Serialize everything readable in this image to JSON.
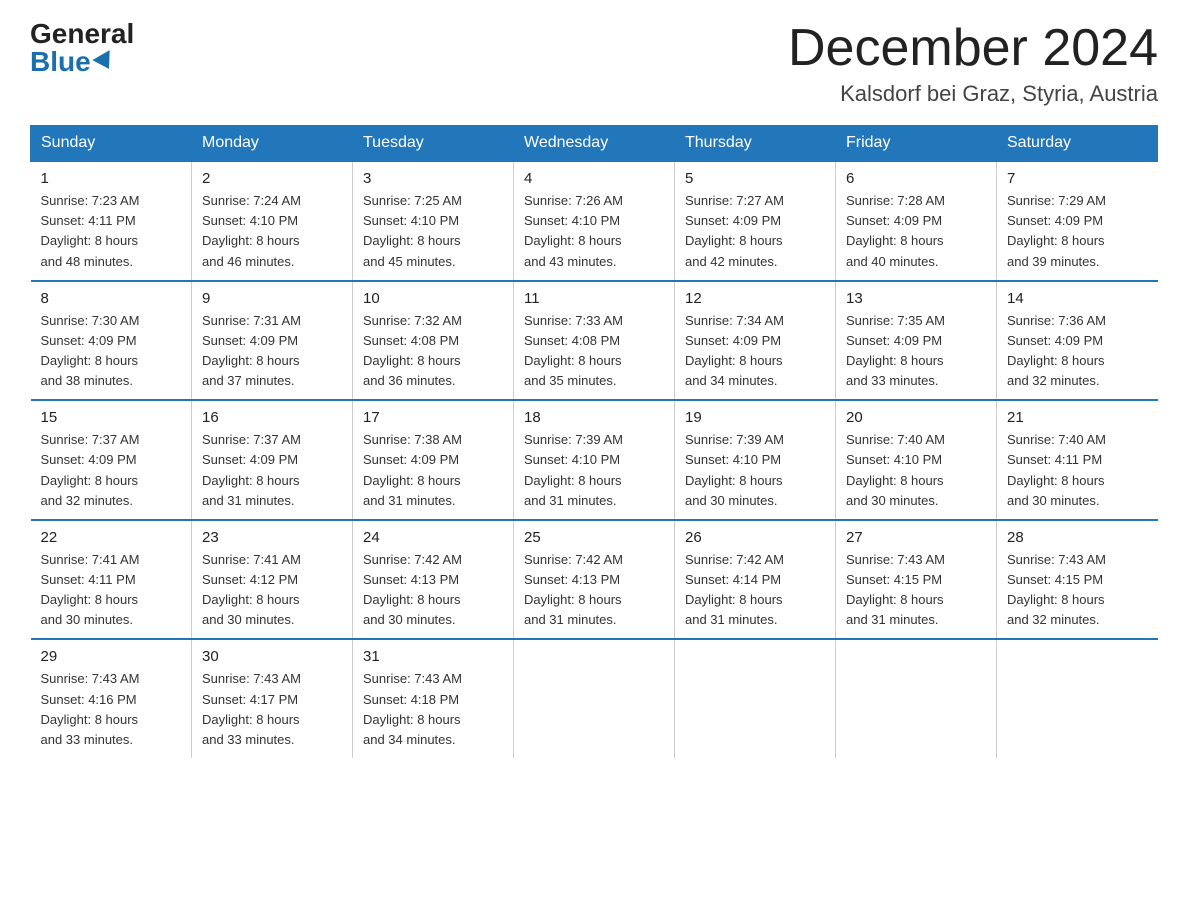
{
  "header": {
    "logo_general": "General",
    "logo_blue": "Blue",
    "month_title": "December 2024",
    "location": "Kalsdorf bei Graz, Styria, Austria"
  },
  "weekdays": [
    "Sunday",
    "Monday",
    "Tuesday",
    "Wednesday",
    "Thursday",
    "Friday",
    "Saturday"
  ],
  "weeks": [
    [
      {
        "day": "1",
        "info": "Sunrise: 7:23 AM\nSunset: 4:11 PM\nDaylight: 8 hours\nand 48 minutes."
      },
      {
        "day": "2",
        "info": "Sunrise: 7:24 AM\nSunset: 4:10 PM\nDaylight: 8 hours\nand 46 minutes."
      },
      {
        "day": "3",
        "info": "Sunrise: 7:25 AM\nSunset: 4:10 PM\nDaylight: 8 hours\nand 45 minutes."
      },
      {
        "day": "4",
        "info": "Sunrise: 7:26 AM\nSunset: 4:10 PM\nDaylight: 8 hours\nand 43 minutes."
      },
      {
        "day": "5",
        "info": "Sunrise: 7:27 AM\nSunset: 4:09 PM\nDaylight: 8 hours\nand 42 minutes."
      },
      {
        "day": "6",
        "info": "Sunrise: 7:28 AM\nSunset: 4:09 PM\nDaylight: 8 hours\nand 40 minutes."
      },
      {
        "day": "7",
        "info": "Sunrise: 7:29 AM\nSunset: 4:09 PM\nDaylight: 8 hours\nand 39 minutes."
      }
    ],
    [
      {
        "day": "8",
        "info": "Sunrise: 7:30 AM\nSunset: 4:09 PM\nDaylight: 8 hours\nand 38 minutes."
      },
      {
        "day": "9",
        "info": "Sunrise: 7:31 AM\nSunset: 4:09 PM\nDaylight: 8 hours\nand 37 minutes."
      },
      {
        "day": "10",
        "info": "Sunrise: 7:32 AM\nSunset: 4:08 PM\nDaylight: 8 hours\nand 36 minutes."
      },
      {
        "day": "11",
        "info": "Sunrise: 7:33 AM\nSunset: 4:08 PM\nDaylight: 8 hours\nand 35 minutes."
      },
      {
        "day": "12",
        "info": "Sunrise: 7:34 AM\nSunset: 4:09 PM\nDaylight: 8 hours\nand 34 minutes."
      },
      {
        "day": "13",
        "info": "Sunrise: 7:35 AM\nSunset: 4:09 PM\nDaylight: 8 hours\nand 33 minutes."
      },
      {
        "day": "14",
        "info": "Sunrise: 7:36 AM\nSunset: 4:09 PM\nDaylight: 8 hours\nand 32 minutes."
      }
    ],
    [
      {
        "day": "15",
        "info": "Sunrise: 7:37 AM\nSunset: 4:09 PM\nDaylight: 8 hours\nand 32 minutes."
      },
      {
        "day": "16",
        "info": "Sunrise: 7:37 AM\nSunset: 4:09 PM\nDaylight: 8 hours\nand 31 minutes."
      },
      {
        "day": "17",
        "info": "Sunrise: 7:38 AM\nSunset: 4:09 PM\nDaylight: 8 hours\nand 31 minutes."
      },
      {
        "day": "18",
        "info": "Sunrise: 7:39 AM\nSunset: 4:10 PM\nDaylight: 8 hours\nand 31 minutes."
      },
      {
        "day": "19",
        "info": "Sunrise: 7:39 AM\nSunset: 4:10 PM\nDaylight: 8 hours\nand 30 minutes."
      },
      {
        "day": "20",
        "info": "Sunrise: 7:40 AM\nSunset: 4:10 PM\nDaylight: 8 hours\nand 30 minutes."
      },
      {
        "day": "21",
        "info": "Sunrise: 7:40 AM\nSunset: 4:11 PM\nDaylight: 8 hours\nand 30 minutes."
      }
    ],
    [
      {
        "day": "22",
        "info": "Sunrise: 7:41 AM\nSunset: 4:11 PM\nDaylight: 8 hours\nand 30 minutes."
      },
      {
        "day": "23",
        "info": "Sunrise: 7:41 AM\nSunset: 4:12 PM\nDaylight: 8 hours\nand 30 minutes."
      },
      {
        "day": "24",
        "info": "Sunrise: 7:42 AM\nSunset: 4:13 PM\nDaylight: 8 hours\nand 30 minutes."
      },
      {
        "day": "25",
        "info": "Sunrise: 7:42 AM\nSunset: 4:13 PM\nDaylight: 8 hours\nand 31 minutes."
      },
      {
        "day": "26",
        "info": "Sunrise: 7:42 AM\nSunset: 4:14 PM\nDaylight: 8 hours\nand 31 minutes."
      },
      {
        "day": "27",
        "info": "Sunrise: 7:43 AM\nSunset: 4:15 PM\nDaylight: 8 hours\nand 31 minutes."
      },
      {
        "day": "28",
        "info": "Sunrise: 7:43 AM\nSunset: 4:15 PM\nDaylight: 8 hours\nand 32 minutes."
      }
    ],
    [
      {
        "day": "29",
        "info": "Sunrise: 7:43 AM\nSunset: 4:16 PM\nDaylight: 8 hours\nand 33 minutes."
      },
      {
        "day": "30",
        "info": "Sunrise: 7:43 AM\nSunset: 4:17 PM\nDaylight: 8 hours\nand 33 minutes."
      },
      {
        "day": "31",
        "info": "Sunrise: 7:43 AM\nSunset: 4:18 PM\nDaylight: 8 hours\nand 34 minutes."
      },
      {
        "day": "",
        "info": ""
      },
      {
        "day": "",
        "info": ""
      },
      {
        "day": "",
        "info": ""
      },
      {
        "day": "",
        "info": ""
      }
    ]
  ]
}
